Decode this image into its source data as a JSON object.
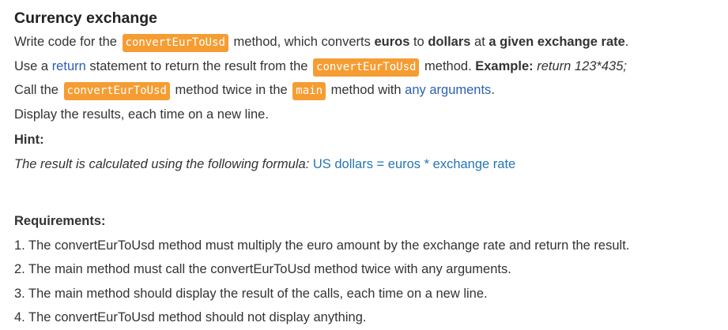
{
  "title": "Currency exchange",
  "task": {
    "line1": {
      "t1": "Write code for the ",
      "code1": "convertEurToUsd",
      "t2": " method, which converts ",
      "b1": "euros",
      "t3": " to ",
      "b2": "dollars",
      "t4": " at ",
      "b3": "a given exchange rate",
      "t5": "."
    },
    "line2": {
      "t1": "Use a ",
      "link1": "return",
      "t2": " statement to return the result from the ",
      "code1": "convertEurToUsd",
      "t3": " method. ",
      "b1": "Example:",
      "i1": " return 123*435;"
    },
    "line3": {
      "t1": "Call the ",
      "code1": "convertEurToUsd",
      "t2": " method twice in the ",
      "code2": "main",
      "t3": " method with ",
      "link1": "any arguments",
      "t4": "."
    },
    "line4": "Display the results, each time on a new line."
  },
  "hint": {
    "title": "Hint:",
    "text": "The result is calculated using the following formula: ",
    "formula": "US dollars = euros * exchange rate"
  },
  "requirements": {
    "title": "Requirements:",
    "items": [
      "1. The convertEurToUsd method must multiply the euro amount by the exchange rate and return the result.",
      "2. The main method must call the convertEurToUsd method twice with any arguments.",
      "3. The main method should display the result of the calls, each time on a new line.",
      "4. The convertEurToUsd method should not display anything."
    ]
  },
  "colors": {
    "code_bg": "#f59d32",
    "link": "#2b5fb5",
    "formula": "#2476b4"
  }
}
